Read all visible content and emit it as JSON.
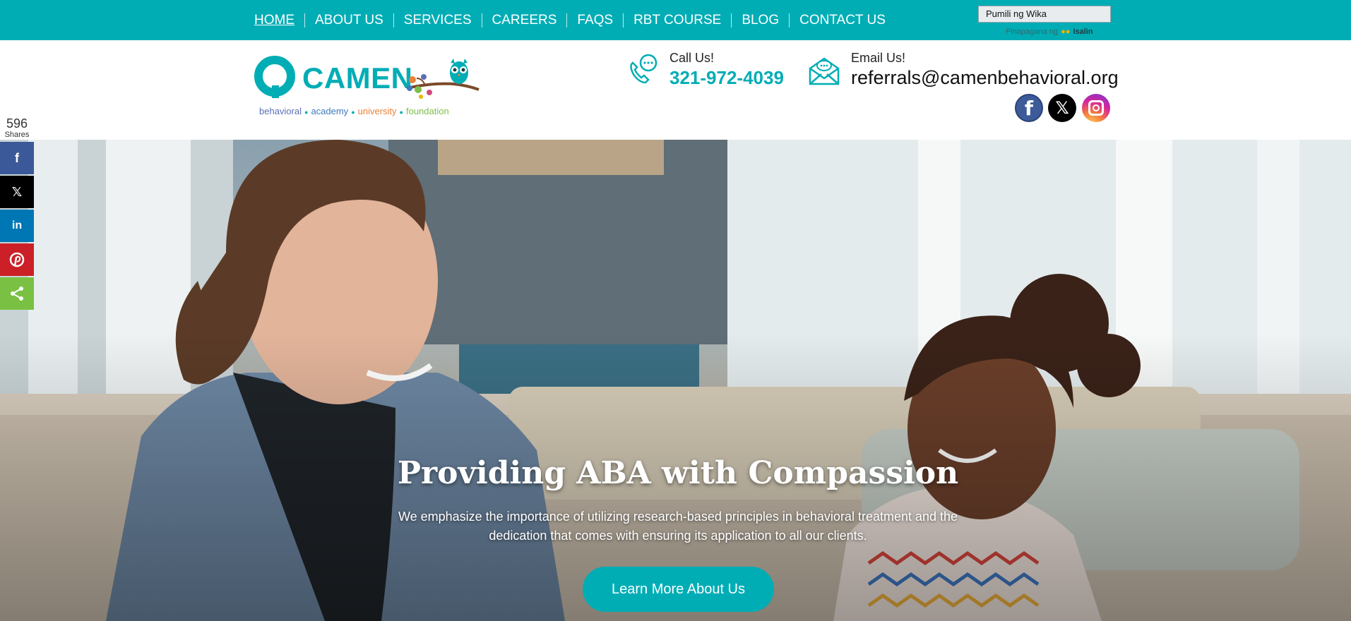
{
  "nav": {
    "items": [
      {
        "label": "HOME",
        "active": true
      },
      {
        "label": "ABOUT US"
      },
      {
        "label": "SERVICES"
      },
      {
        "label": "CAREERS"
      },
      {
        "label": "FAQS"
      },
      {
        "label": "RBT COURSE"
      },
      {
        "label": "BLOG"
      },
      {
        "label": "CONTACT US"
      }
    ]
  },
  "translate": {
    "select_label": "Pumili ng Wika",
    "powered_by": "Pinapagana ng",
    "translate_link": "Isalin"
  },
  "logo": {
    "wordmark": "CAMEN",
    "tagline": [
      "behavioral",
      "academy",
      "university",
      "foundation"
    ]
  },
  "contact": {
    "call_label": "Call Us!",
    "phone": "321-972-4039",
    "email_label": "Email Us!",
    "email": "referrals@camenbehavioral.org"
  },
  "social": {
    "facebook_glyph": "f",
    "x_glyph": "𝕏"
  },
  "share": {
    "count": "596",
    "count_label": "Shares",
    "facebook_glyph": "f",
    "x_glyph": "𝕏",
    "linkedin_glyph": "in"
  },
  "hero": {
    "title": "Providing ABA with Compassion",
    "subtitle": "We emphasize the importance of utilizing research-based principles in behavioral treatment and the dedication that comes with ensuring its application to all our clients.",
    "cta_label": "Learn More About Us"
  },
  "colors": {
    "brand_teal": "#00adb5",
    "facebook": "#3b5998",
    "linkedin": "#0077b5",
    "pinterest": "#cb2027",
    "share_green": "#7ac143"
  }
}
